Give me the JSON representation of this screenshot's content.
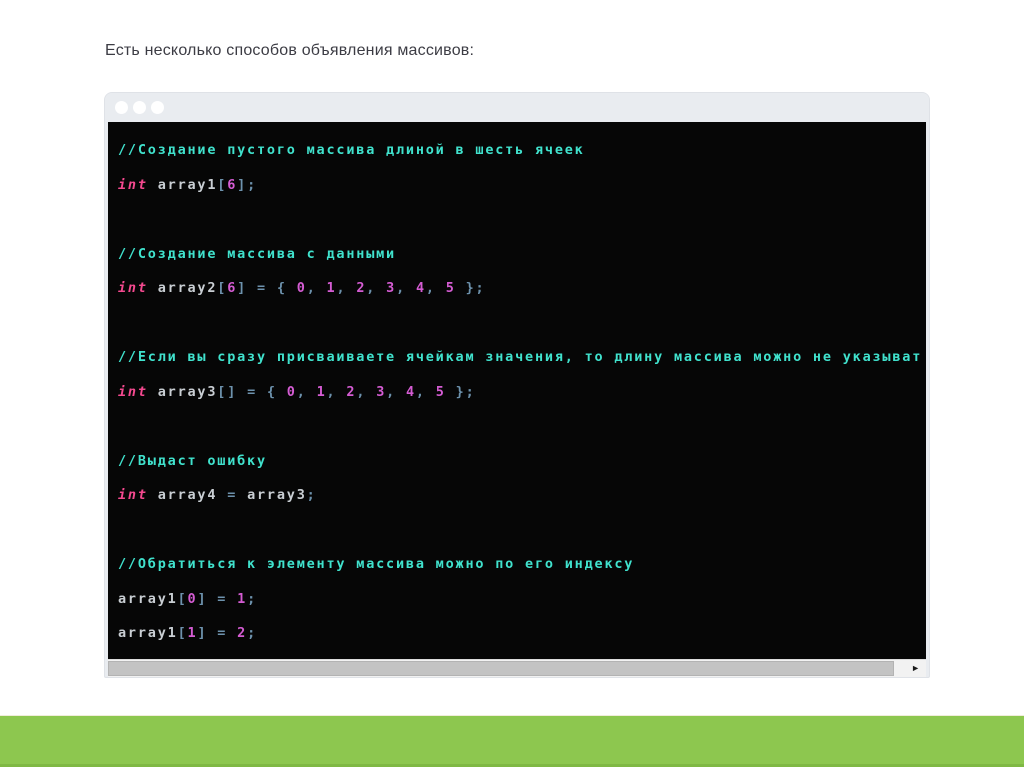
{
  "colors": {
    "title-text": "#3c3c44",
    "titlebar-bg": "#e9ecf0",
    "window-border": "#dfe2e7",
    "code-bg": "#060606",
    "comment": "#40e2cd",
    "keyword": "#f4498f",
    "number": "#d55cd3",
    "plain": "#c9ced3",
    "punct": "#6d92ad",
    "scroll-track": "#f2f2f2",
    "scroll-thumb": "#c3c3c3",
    "accent-green": "#8dc74f",
    "accent-green-dark": "#7fb844"
  },
  "slide": {
    "title": "Есть несколько способов объявления массивов:"
  },
  "icons": {
    "scroll_right_arrow": "►"
  },
  "code": {
    "lines": [
      {
        "tokens": [
          {
            "type": "comment",
            "text": "//Создание пустого массива длиной в шесть ячеек"
          }
        ]
      },
      {
        "tokens": [
          {
            "type": "keyword",
            "text": "int"
          },
          {
            "type": "plain",
            "text": " array1"
          },
          {
            "type": "punct",
            "text": "["
          },
          {
            "type": "number",
            "text": "6"
          },
          {
            "type": "punct",
            "text": "];"
          }
        ]
      },
      {
        "tokens": []
      },
      {
        "tokens": [
          {
            "type": "comment",
            "text": "//Создание массива с данными"
          }
        ]
      },
      {
        "tokens": [
          {
            "type": "keyword",
            "text": "int"
          },
          {
            "type": "plain",
            "text": " array2"
          },
          {
            "type": "punct",
            "text": "["
          },
          {
            "type": "number",
            "text": "6"
          },
          {
            "type": "punct",
            "text": "] = { "
          },
          {
            "type": "number",
            "text": "0"
          },
          {
            "type": "punct",
            "text": ", "
          },
          {
            "type": "number",
            "text": "1"
          },
          {
            "type": "punct",
            "text": ", "
          },
          {
            "type": "number",
            "text": "2"
          },
          {
            "type": "punct",
            "text": ", "
          },
          {
            "type": "number",
            "text": "3"
          },
          {
            "type": "punct",
            "text": ", "
          },
          {
            "type": "number",
            "text": "4"
          },
          {
            "type": "punct",
            "text": ", "
          },
          {
            "type": "number",
            "text": "5"
          },
          {
            "type": "punct",
            "text": " };"
          }
        ]
      },
      {
        "tokens": []
      },
      {
        "tokens": [
          {
            "type": "comment",
            "text": "//Если вы сразу присваиваете ячейкам значения, то длину массива можно не указыват"
          }
        ]
      },
      {
        "tokens": [
          {
            "type": "keyword",
            "text": "int"
          },
          {
            "type": "plain",
            "text": " array3"
          },
          {
            "type": "punct",
            "text": "[] = { "
          },
          {
            "type": "number",
            "text": "0"
          },
          {
            "type": "punct",
            "text": ", "
          },
          {
            "type": "number",
            "text": "1"
          },
          {
            "type": "punct",
            "text": ", "
          },
          {
            "type": "number",
            "text": "2"
          },
          {
            "type": "punct",
            "text": ", "
          },
          {
            "type": "number",
            "text": "3"
          },
          {
            "type": "punct",
            "text": ", "
          },
          {
            "type": "number",
            "text": "4"
          },
          {
            "type": "punct",
            "text": ", "
          },
          {
            "type": "number",
            "text": "5"
          },
          {
            "type": "punct",
            "text": " };"
          }
        ]
      },
      {
        "tokens": []
      },
      {
        "tokens": [
          {
            "type": "comment",
            "text": "//Выдаст ошибку"
          }
        ]
      },
      {
        "tokens": [
          {
            "type": "keyword",
            "text": "int"
          },
          {
            "type": "plain",
            "text": " array4 "
          },
          {
            "type": "punct",
            "text": "= "
          },
          {
            "type": "plain",
            "text": "array3"
          },
          {
            "type": "punct",
            "text": ";"
          }
        ]
      },
      {
        "tokens": []
      },
      {
        "tokens": [
          {
            "type": "comment",
            "text": "//Обратиться к элементу массива можно по его индексу"
          }
        ]
      },
      {
        "tokens": [
          {
            "type": "plain",
            "text": "array1"
          },
          {
            "type": "punct",
            "text": "["
          },
          {
            "type": "number",
            "text": "0"
          },
          {
            "type": "punct",
            "text": "] = "
          },
          {
            "type": "number",
            "text": "1"
          },
          {
            "type": "punct",
            "text": ";"
          }
        ]
      },
      {
        "tokens": [
          {
            "type": "plain",
            "text": "array1"
          },
          {
            "type": "punct",
            "text": "["
          },
          {
            "type": "number",
            "text": "1"
          },
          {
            "type": "punct",
            "text": "] = "
          },
          {
            "type": "number",
            "text": "2"
          },
          {
            "type": "punct",
            "text": ";"
          }
        ]
      }
    ]
  }
}
